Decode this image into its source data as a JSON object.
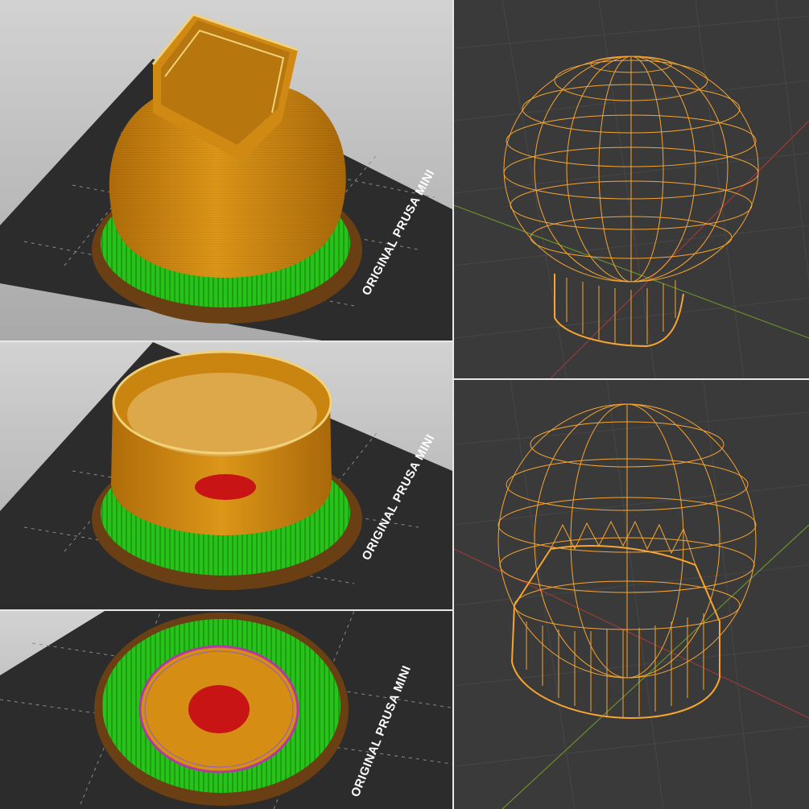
{
  "views": {
    "slicer_full": {
      "bed_label": "ORIGINAL PRUSA MINI"
    },
    "slicer_cut": {
      "bed_label": "ORIGINAL PRUSA MINI"
    },
    "slicer_base": {
      "bed_label": "ORIGINAL PRUSA MINI"
    },
    "wireframe_top": {},
    "wireframe_bottom": {}
  },
  "colors": {
    "model_orange": "#d58d14",
    "support_green": "#27c21a",
    "brim_brown": "#6b3f14",
    "bed_dark": "#2c2c2c",
    "wire_orange": "#f7a531",
    "first_layer_red": "#c81414",
    "blender_bg": "#3a3a3a"
  },
  "icons": [
    "print-bed-icon",
    "wireframe-mesh-icon"
  ]
}
